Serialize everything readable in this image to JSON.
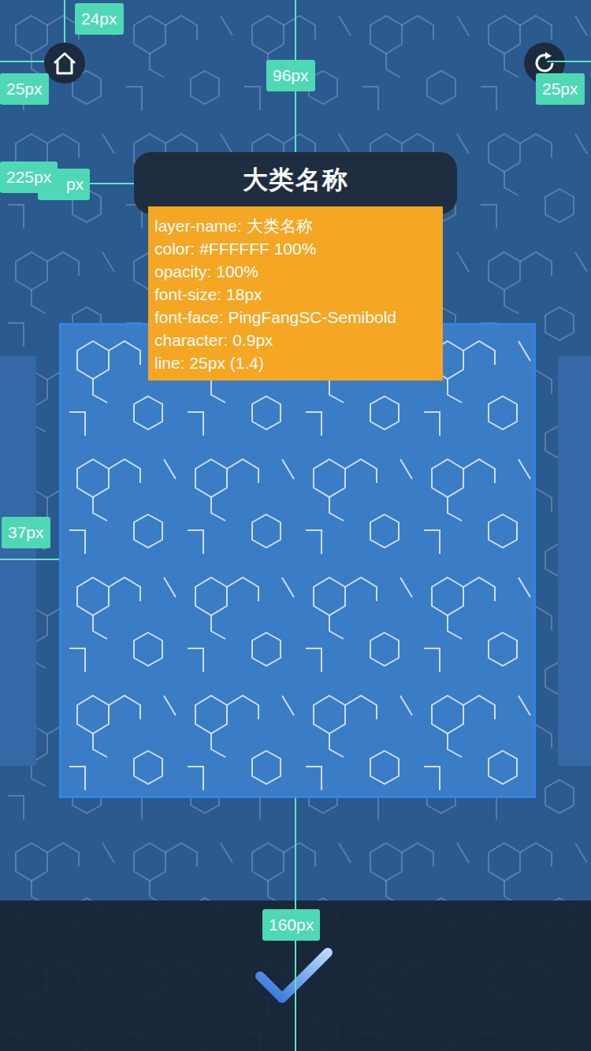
{
  "title": "大类名称",
  "tooltip": {
    "lines": [
      "layer-name: 大类名称",
      "color: #FFFFFF 100%",
      "opacity: 100%",
      "font-size: 18px",
      "font-face: PingFangSC-Semibold",
      "character: 0.9px",
      "line: 25px (1.4)"
    ]
  },
  "cards": [
    {
      "selected": false
    },
    {
      "selected": true
    },
    {
      "selected": false
    }
  ],
  "annotations": [
    "24px",
    "25px",
    "96px",
    "25px",
    "px",
    "225px",
    "37px",
    "160px"
  ]
}
